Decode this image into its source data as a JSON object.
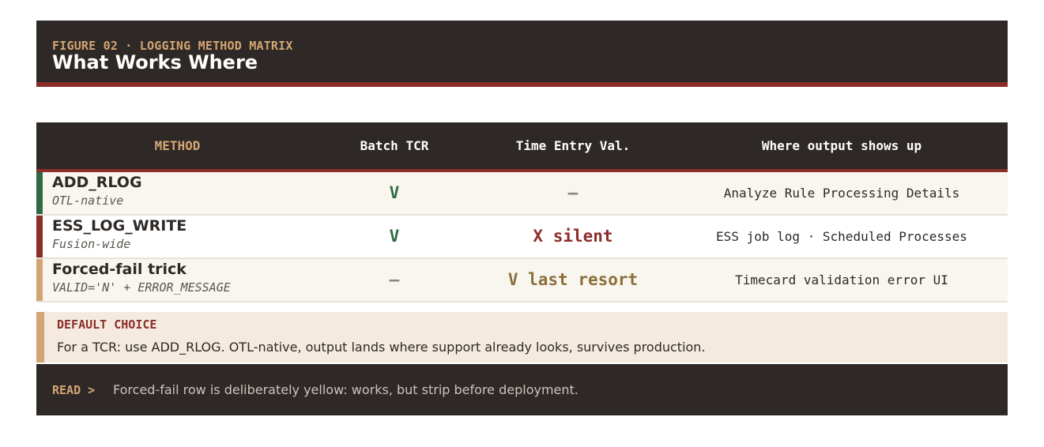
{
  "header": {
    "kicker": "FIGURE 02 · LOGGING METHOD MATRIX",
    "title": "What Works Where"
  },
  "table": {
    "columns": [
      "METHOD",
      "Batch TCR",
      "Time Entry Val.",
      "Where output shows up"
    ],
    "rows": [
      {
        "name": "ADD_RLOG",
        "sub": "OTL-native",
        "accent": "#2e6b45",
        "batch": {
          "text": "V",
          "color": "#2e6b45"
        },
        "entry": {
          "text": "—",
          "color": "#8c8680"
        },
        "where": "Analyze Rule Processing Details"
      },
      {
        "name": "ESS_LOG_WRITE",
        "sub": "Fusion-wide",
        "accent": "#8b2e2a",
        "batch": {
          "text": "V",
          "color": "#2e6b45"
        },
        "entry": {
          "text": "X silent",
          "color": "#8b2e2a"
        },
        "where": "ESS job log · Scheduled Processes"
      },
      {
        "name": "Forced-fail trick",
        "sub": "VALID='N' + ERROR_MESSAGE",
        "accent": "#d4a574",
        "batch": {
          "text": "—",
          "color": "#8c8680"
        },
        "entry": {
          "text": "V last resort",
          "color": "#8b6f3a"
        },
        "where": "Timecard validation error UI"
      }
    ]
  },
  "default_choice": {
    "label": "DEFAULT CHOICE",
    "text": "For a TCR: use ADD_RLOG. OTL-native, output lands where support already looks, survives production."
  },
  "read": {
    "label": "READ >",
    "text": "Forced-fail row is deliberately yellow: works, but strip before deployment."
  }
}
